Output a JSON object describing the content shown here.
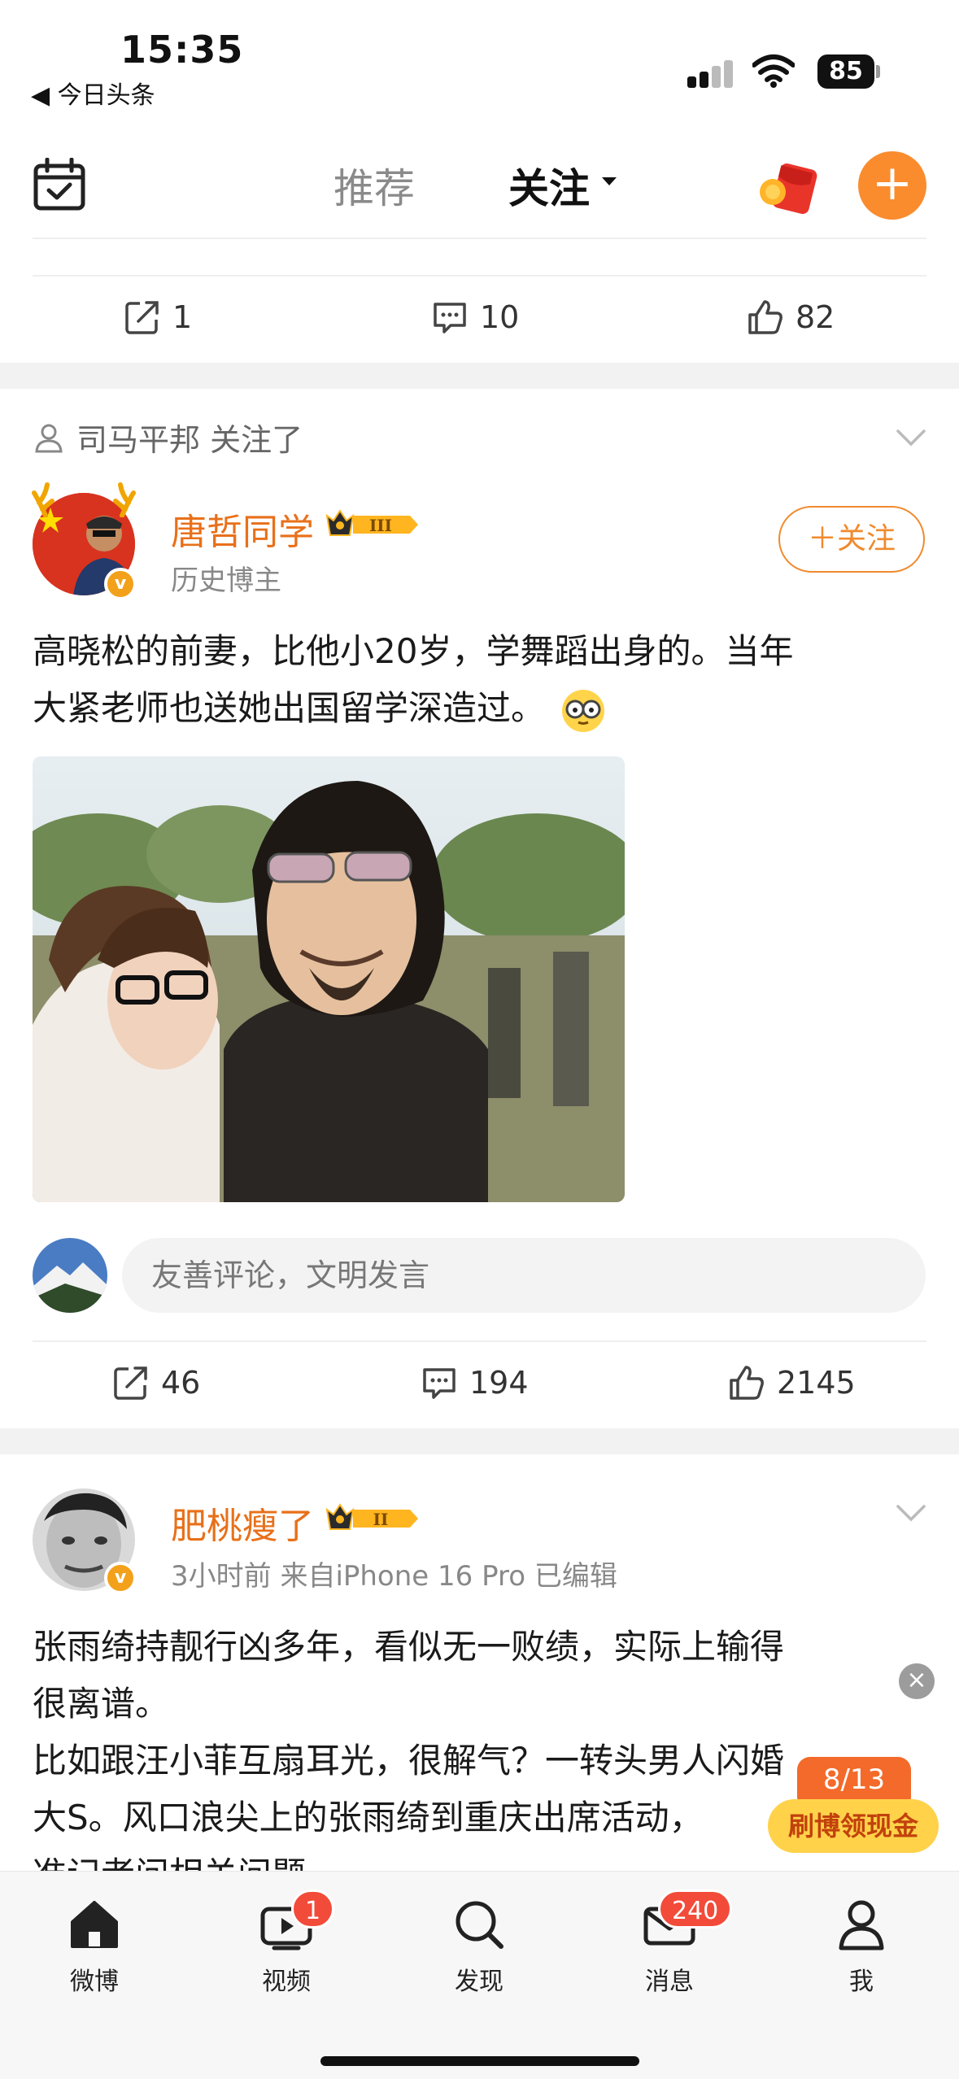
{
  "status_bar": {
    "time": "15:35",
    "back_app": "◀ 今日头条",
    "battery": "85"
  },
  "top_nav": {
    "tabs": [
      {
        "label": "推荐",
        "active": false
      },
      {
        "label": "关注",
        "active": true
      }
    ],
    "accent_color": "#FFA61F"
  },
  "prev_post": {
    "share_count": "1",
    "comment_count": "10",
    "like_count": "82"
  },
  "post1": {
    "follow_hint": "司马平邦 关注了",
    "username": "唐哲同学",
    "level": "III",
    "subtitle": "历史博主",
    "follow_label": "＋关注",
    "text_line1": "高晓松的前妻，比他小20岁，学舞蹈出身的。当年",
    "text_line2": "大紧老师也送她出国留学深造过。",
    "comment_placeholder": "友善评论，文明发言",
    "share_count": "46",
    "comment_count": "194",
    "like_count": "2145"
  },
  "post2": {
    "username": "肥桃瘦了",
    "level": "II",
    "meta": "3小时前  来自iPhone 16 Pro  已编辑",
    "text_line1": "张雨绮持靓行凶多年，看似无一败绩，实际上输得",
    "text_line2": "很离谱。",
    "text_line3": "比如跟汪小菲互扇耳光，很解气？一转头男人闪婚",
    "text_line4": "大S。风口浪尖上的张雨绮到重庆出席活动，",
    "text_line5": "准记者问相关问题"
  },
  "promo": {
    "count": "8/13",
    "label": "刷博领现金"
  },
  "bottom_nav": {
    "items": [
      {
        "label": "微博",
        "icon": "home-icon"
      },
      {
        "label": "视频",
        "icon": "video-icon",
        "badge": "1"
      },
      {
        "label": "发现",
        "icon": "search-icon"
      },
      {
        "label": "消息",
        "icon": "mail-icon",
        "badge": "240"
      },
      {
        "label": "我",
        "icon": "profile-icon"
      }
    ]
  }
}
